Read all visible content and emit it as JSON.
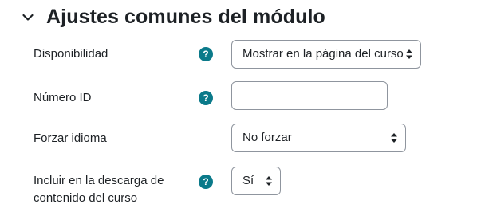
{
  "section": {
    "title": "Ajustes comunes del módulo",
    "collapse_icon": "chevron-down-icon"
  },
  "fields": {
    "availability": {
      "label": "Disponibilidad",
      "help": "?",
      "value": "Mostrar en la página del curso"
    },
    "id_number": {
      "label": "Número ID",
      "help": "?",
      "value": ""
    },
    "force_language": {
      "label": "Forzar idioma",
      "value": "No forzar"
    },
    "include_download": {
      "label": "Incluir en la descarga de contenido del curso",
      "help": "?",
      "value": "Sí"
    }
  },
  "colors": {
    "help_icon": "#0b7a8a",
    "text": "#1d2125",
    "border": "#8f959e"
  }
}
